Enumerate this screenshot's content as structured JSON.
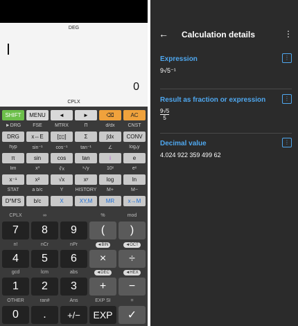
{
  "display": {
    "angle_mode": "DEG",
    "result": "0",
    "mode": "CPLX"
  },
  "top_keys": [
    "SHIFT",
    "MENU",
    "◄",
    "►",
    "⌫",
    "AC"
  ],
  "rows": [
    {
      "labels": [
        "►DRG",
        "FSE",
        "MTRX",
        "Π",
        "d/dx",
        "CNST"
      ],
      "keys": [
        "DRG",
        "x⇔E",
        "[▯▯]",
        "Σ",
        "∫dx",
        "CONV"
      ]
    },
    {
      "labels": [
        "hyp",
        "sin⁻¹",
        "cos⁻¹",
        "tan⁻¹",
        "∠",
        "logₓy"
      ],
      "keys": [
        "π",
        "sin",
        "cos",
        "tan",
        "i",
        "e"
      ]
    },
    {
      "labels": [
        "lim",
        "x³",
        "∛x",
        "ˣ√y",
        "10ˣ",
        "eˣ"
      ],
      "keys": [
        "x⁻¹",
        "x²",
        "√x",
        "xʸ",
        "log",
        "ln"
      ]
    },
    {
      "labels": [
        "STAT",
        "a b/c",
        "Y",
        "HISTORY",
        "M+",
        "M−"
      ],
      "keys": [
        "D°M'S",
        "b/c",
        "X",
        "XY,M",
        "MR",
        "x→M"
      ]
    }
  ],
  "numpad": [
    {
      "labels": [
        "CPLX",
        "∞",
        "",
        "",
        "%",
        "mod"
      ],
      "keys": [
        "7",
        "8",
        "9",
        "(",
        ")"
      ]
    },
    {
      "labels": [
        "n!",
        "nCr",
        "nPr",
        "◄BIN",
        "◄OCT"
      ],
      "keys": [
        "4",
        "5",
        "6",
        "×",
        "÷"
      ]
    },
    {
      "labels": [
        "gcd",
        "lcm",
        "abs",
        "◄DEC",
        "◄HEX"
      ],
      "keys": [
        "1",
        "2",
        "3",
        "+",
        "−"
      ]
    },
    {
      "labels": [
        "OTHER",
        "ran#",
        "Ans",
        "EXP SI",
        "="
      ],
      "keys": [
        "0",
        ".",
        "+/−",
        "EXP",
        "✓"
      ]
    }
  ],
  "details": {
    "title": "Calculation details",
    "sections": [
      {
        "heading": "Expression",
        "value": "9√5⁻¹"
      },
      {
        "heading": "Result as fraction or expression",
        "numerator": "9√5",
        "denominator": "5"
      },
      {
        "heading": "Decimal value",
        "value": "4.024 922 359 499 62"
      }
    ]
  },
  "colors": {
    "shift": "#6cbf4a",
    "orange": "#f0a23c",
    "accent": "#4fa8f0"
  }
}
